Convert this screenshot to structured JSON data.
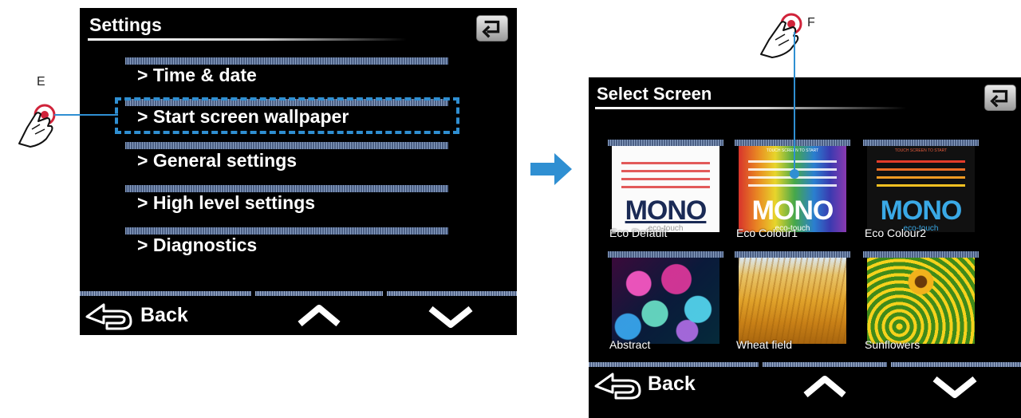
{
  "left_screen": {
    "title": "Settings",
    "menu": [
      {
        "label": "> Time & date"
      },
      {
        "label": "> Start screen wallpaper"
      },
      {
        "label": "> General settings"
      },
      {
        "label": "> High level settings"
      },
      {
        "label": "> Diagnostics"
      }
    ],
    "back_label": "Back",
    "annotation": "E"
  },
  "right_screen": {
    "title": "Select Screen",
    "wallpapers": [
      {
        "caption": "Eco Default",
        "logo": "MONO",
        "sub": "eco-touch"
      },
      {
        "caption": "Eco Colour1",
        "logo": "MONO",
        "sub": "eco-touch",
        "touch_text": "TOUCH SCREEN TO START"
      },
      {
        "caption": "Eco Colour2",
        "logo": "MONO",
        "sub": "eco-touch",
        "touch_text": "TOUCH SCREEN TO START"
      },
      {
        "caption": "Abstract"
      },
      {
        "caption": "Wheat field"
      },
      {
        "caption": "Sunflowers"
      }
    ],
    "back_label": "Back",
    "annotation": "F"
  },
  "colors": {
    "highlight": "#2f8fd2",
    "screen_bg": "#000000",
    "bar": "#4b5f84"
  },
  "icons": [
    "return-icon",
    "back-arrow-icon",
    "up-chevron-icon",
    "down-chevron-icon",
    "tap-hand-icon",
    "flow-arrow-icon"
  ]
}
